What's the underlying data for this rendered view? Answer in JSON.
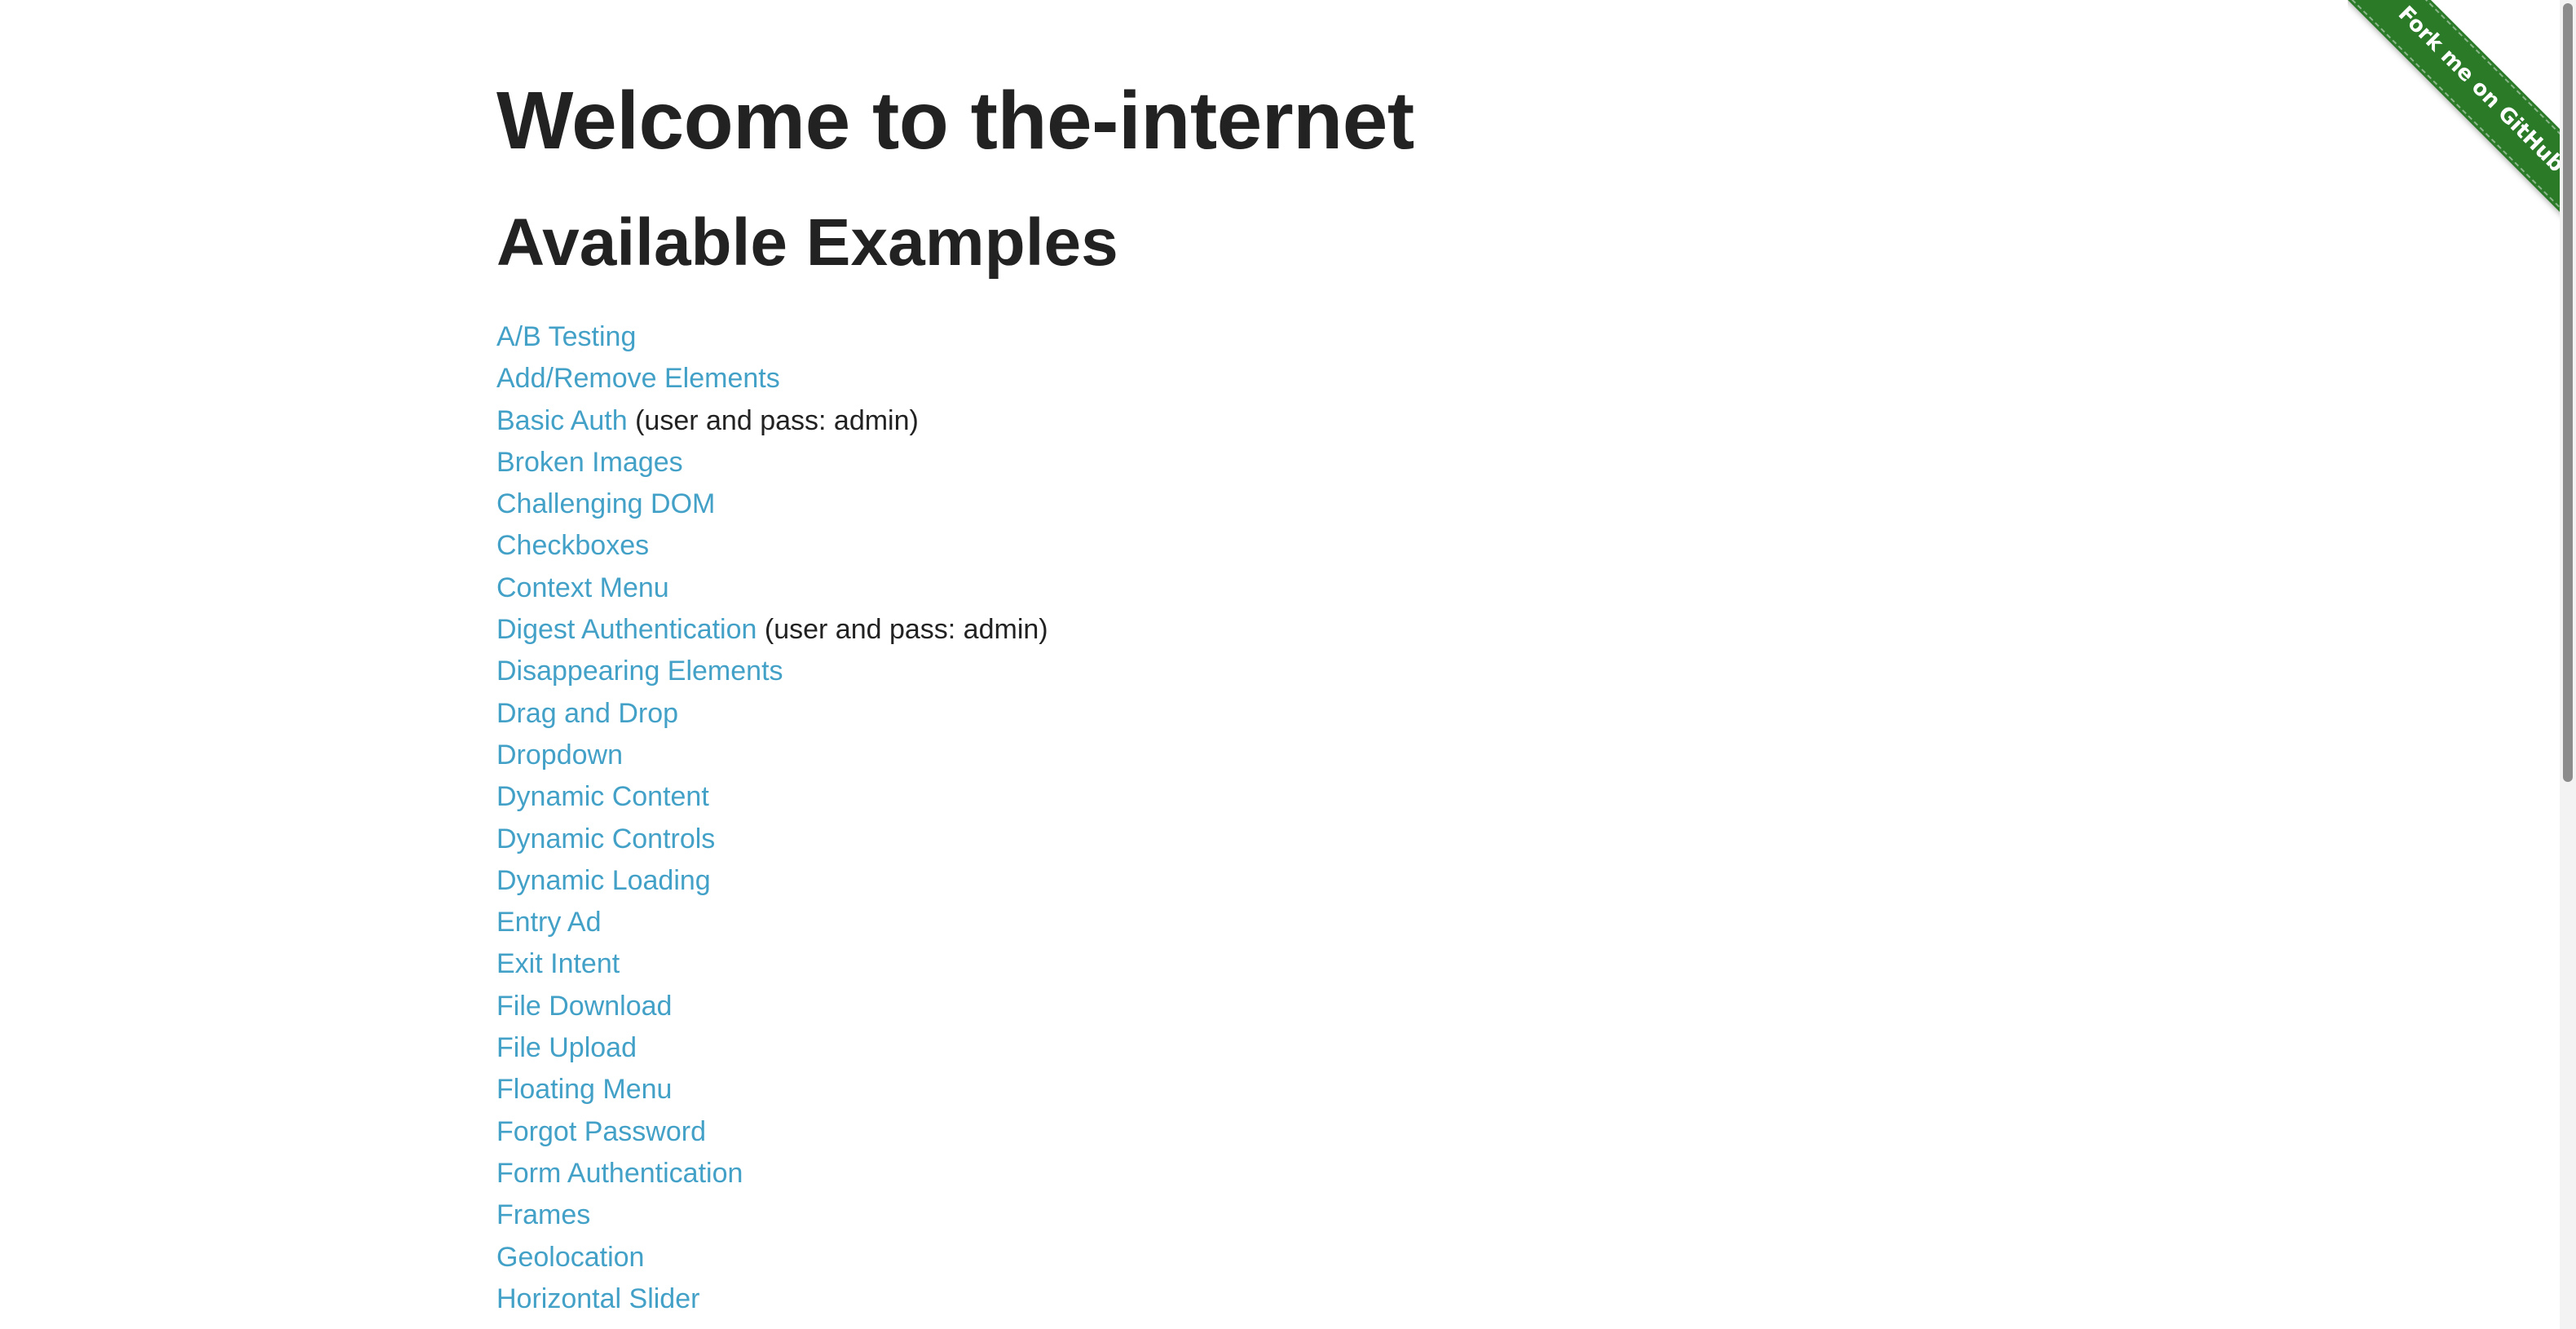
{
  "header": {
    "title": "Welcome to the-internet",
    "subtitle": "Available Examples"
  },
  "ribbon": {
    "label": "Fork me on GitHub",
    "color": "#2a7a28"
  },
  "colors": {
    "link": "#43a1c8",
    "text": "#222222"
  },
  "examples": [
    {
      "label": "A/B Testing",
      "note": ""
    },
    {
      "label": "Add/Remove Elements",
      "note": ""
    },
    {
      "label": "Basic Auth",
      "note": "(user and pass: admin)"
    },
    {
      "label": "Broken Images",
      "note": ""
    },
    {
      "label": "Challenging DOM",
      "note": ""
    },
    {
      "label": "Checkboxes",
      "note": ""
    },
    {
      "label": "Context Menu",
      "note": ""
    },
    {
      "label": "Digest Authentication",
      "note": "(user and pass: admin)"
    },
    {
      "label": "Disappearing Elements",
      "note": ""
    },
    {
      "label": "Drag and Drop",
      "note": ""
    },
    {
      "label": "Dropdown",
      "note": ""
    },
    {
      "label": "Dynamic Content",
      "note": ""
    },
    {
      "label": "Dynamic Controls",
      "note": ""
    },
    {
      "label": "Dynamic Loading",
      "note": ""
    },
    {
      "label": "Entry Ad",
      "note": ""
    },
    {
      "label": "Exit Intent",
      "note": ""
    },
    {
      "label": "File Download",
      "note": ""
    },
    {
      "label": "File Upload",
      "note": ""
    },
    {
      "label": "Floating Menu",
      "note": ""
    },
    {
      "label": "Forgot Password",
      "note": ""
    },
    {
      "label": "Form Authentication",
      "note": ""
    },
    {
      "label": "Frames",
      "note": ""
    },
    {
      "label": "Geolocation",
      "note": ""
    },
    {
      "label": "Horizontal Slider",
      "note": ""
    }
  ]
}
